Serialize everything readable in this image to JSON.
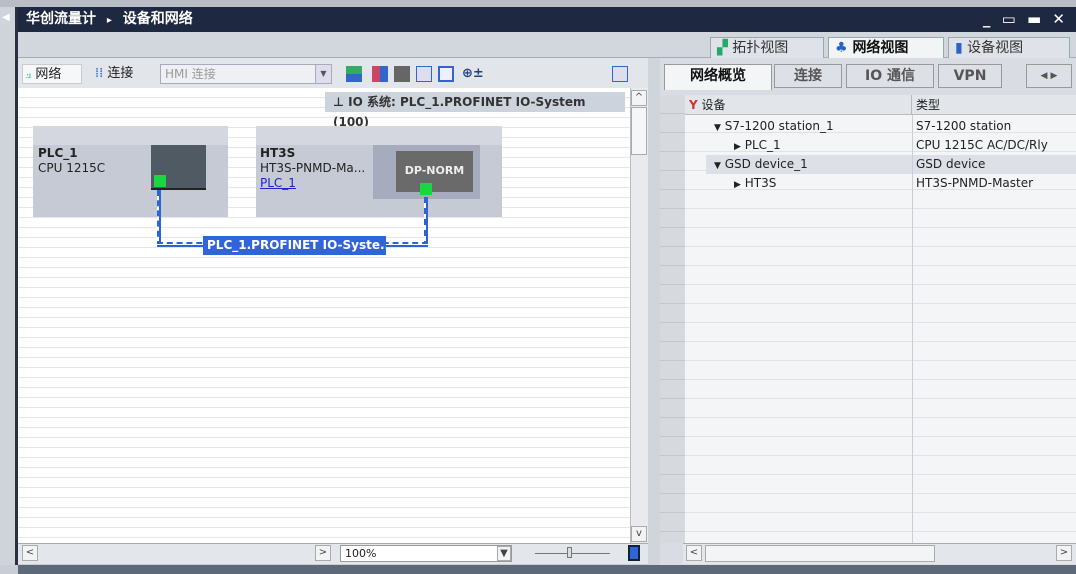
{
  "title": {
    "breadcrumb_project": "华创流量计",
    "breadcrumb_sep": "▸",
    "breadcrumb_page": "设备和网络",
    "window_controls": "_ ▭ ▬ ✕"
  },
  "views": [
    {
      "label": "拓扑视图",
      "icon": "topology-icon"
    },
    {
      "label": "网络视图",
      "icon": "network-view-icon",
      "active": true
    },
    {
      "label": "设备视图",
      "icon": "device-view-icon"
    }
  ],
  "toolbar": {
    "network_label": "网络",
    "connections_label": "连接",
    "hmi_select": "HMI 连接",
    "zoom_icon": "⊕±"
  },
  "canvas": {
    "io_system_label": "IO 系统: PLC_1.PROFINET IO-System (100)",
    "devices": [
      {
        "name": "PLC_1",
        "type": "CPU 1215C"
      },
      {
        "name": "HT3S",
        "type": "HT3S-PNMD-Ma...",
        "link": "PLC_1",
        "module_label": "DP-NORM"
      }
    ],
    "network_label": "PLC_1.PROFINET IO-Syste...",
    "zoom": "100%"
  },
  "overview": {
    "tabs": [
      {
        "label": "网络概览",
        "active": true
      },
      {
        "label": "连接"
      },
      {
        "label": "IO 通信"
      },
      {
        "label": "VPN"
      }
    ],
    "columns": [
      "设备",
      "类型"
    ],
    "rows": [
      {
        "expander": "▼",
        "indent": 0,
        "device": "S7-1200 station_1",
        "type": "S7-1200 station"
      },
      {
        "expander": "▶",
        "indent": 1,
        "device": "PLC_1",
        "type": "CPU 1215C AC/DC/Rly"
      },
      {
        "expander": "▼",
        "indent": 0,
        "device": "GSD device_1",
        "type": "GSD device",
        "selected": true
      },
      {
        "expander": "▶",
        "indent": 1,
        "device": "HT3S",
        "type": "HT3S-PNMD-Master"
      }
    ]
  },
  "colors": {
    "titlebar": "#1e2840",
    "network": "#2f65d9",
    "port": "#19d641"
  }
}
